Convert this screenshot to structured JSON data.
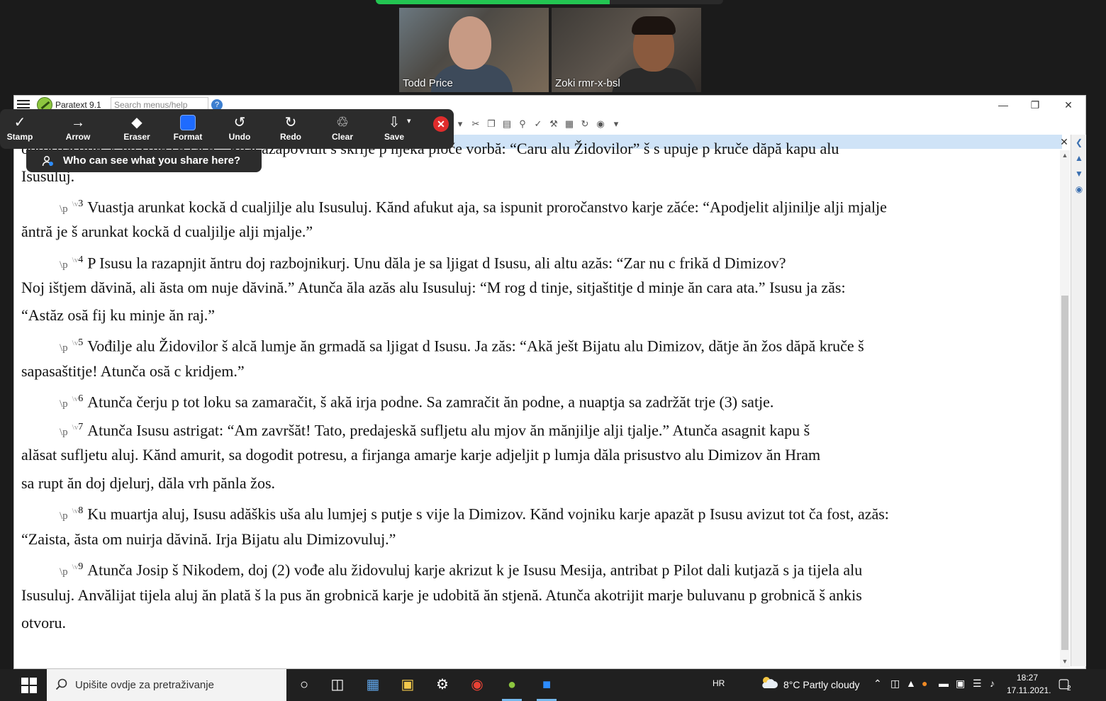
{
  "meeting": {
    "participants": [
      {
        "name": "Todd Price"
      },
      {
        "name": "Zoki rmr-x-bsl"
      }
    ]
  },
  "annotate_toolbar": {
    "tools": [
      {
        "label": "Stamp",
        "icon": "checkmark-icon"
      },
      {
        "label": "Arrow",
        "icon": "arrow-icon"
      },
      {
        "label": "Eraser",
        "icon": "eraser-icon"
      },
      {
        "label": "Format",
        "icon": "format-icon"
      },
      {
        "label": "Undo",
        "icon": "undo-icon"
      },
      {
        "label": "Redo",
        "icon": "redo-icon"
      },
      {
        "label": "Clear",
        "icon": "trash-icon"
      },
      {
        "label": "Save",
        "icon": "download-icon"
      }
    ],
    "who_can_see": "Who can see what you share here?"
  },
  "paratext": {
    "title": "Paratext 9.1",
    "search_placeholder": "Search menus/help",
    "lines": [
      {
        "type": "cont",
        "text": "oprostjastitje, k nu stije ce face.” Pilat azapovidit s skrije p njeka ploče vorbă: “Caru alu Židovilor” š s upuje p kruče dăpă kapu alu"
      },
      {
        "type": "cont",
        "text": "Isusuluj."
      },
      {
        "type": "verse",
        "marker": "\\p",
        "vmark": "\\v",
        "num": "3",
        "text": "Vuastja arunkat kockă d cualjilje alu Isusuluj. Kănd afukut aja, sa ispunit proročanstvo karje zăće: “Apodjelit aljinilje alji mjalje"
      },
      {
        "type": "cont",
        "text": "ăntră je š arunkat kockă d cualjilje alji mjalje.”"
      },
      {
        "type": "verse",
        "marker": "\\p",
        "vmark": "\\v",
        "num": "4",
        "text": "P Isusu la razapnjit ăntru doj razbojnikurj. Unu dăla je sa ljigat d Isusu, ali altu azăs: “Zar nu c frikă d Dimizov?"
      },
      {
        "type": "cont",
        "text": "Noj ištjem dăvină, ali ăsta om nuje dăvină.” Atunča ăla azăs alu Isusuluj: “M rog d tinje, sitjaštitje d minje ăn cara ata.” Isusu ja zăs:"
      },
      {
        "type": "cont",
        "text": "“Astăz osă fij ku minje ăn raj.”"
      },
      {
        "type": "verse",
        "marker": "\\p",
        "vmark": "\\v",
        "num": "5",
        "text": "Vođilje alu Židovilor š alcă lumje ăn grmadă sa ljigat d Isusu. Ja zăs: “Akă ješt Bijatu alu Dimizov, dătje ăn žos dăpă kruče š"
      },
      {
        "type": "cont",
        "text": "sapasaštitje! Atunča osă c kridjem.”"
      },
      {
        "type": "verse",
        "marker": "\\p",
        "vmark": "\\v",
        "num": "6",
        "text": "Atunča čerju p tot loku sa zamaračit, š akă irja podne. Sa zamračit ăn podne, a nuaptja sa zadržăt trje (3) satje."
      },
      {
        "type": "verse",
        "marker": "\\p",
        "vmark": "\\v",
        "num": "7",
        "text": "Atunča Isusu astrigat: “Am završăt! Tato, predajeskă sufljetu alu mjov ăn mănjilje alji tjalje.” Atunča asagnit kapu š"
      },
      {
        "type": "cont",
        "text": "alăsat sufljetu aluj. Kănd amurit, sa dogodit potresu, a firjanga amarje karje adjeljit p lumja dăla prisustvo alu Dimizov ăn Hram"
      },
      {
        "type": "cont",
        "text": "sa rupt ăn doj djelurj, dăla vrh pănla žos."
      },
      {
        "type": "verse",
        "marker": "\\p",
        "vmark": "\\v",
        "num": "8",
        "text": "Ku muartja aluj, Isusu adăškis uša alu lumjej s putje s vije la Dimizov. Kănd vojniku karje apazăt p Isusu avizut tot ča fost, azăs:"
      },
      {
        "type": "cont",
        "text": "“Zaista, ăsta om nuirja dăvină. Irja Bijatu alu Dimizovuluj.”"
      },
      {
        "type": "verse",
        "marker": "\\p",
        "vmark": "\\v",
        "num": "9",
        "text": "Atunča Josip š Nikodem, doj (2) vođe alu židovuluj karje akrizut k je Isusu Mesija, antribat p Pilot dali kutjază s ja tijela alu"
      },
      {
        "type": "cont",
        "text": "Isusuluj. Anvălijat tijela aluj ăn plată š la pus ăn grobnică karje je udobită ăn stjenă. Atunča akotrijit marje buluvanu p grobnică š ankis"
      },
      {
        "type": "cont",
        "text": "otvoru."
      }
    ]
  },
  "taskbar": {
    "search_placeholder": "Upišite ovdje za pretraživanje",
    "language": "HR",
    "weather": "8°C  Partly cloudy",
    "time": "18:27",
    "date": "17.11.2021.",
    "notifications": "2"
  }
}
